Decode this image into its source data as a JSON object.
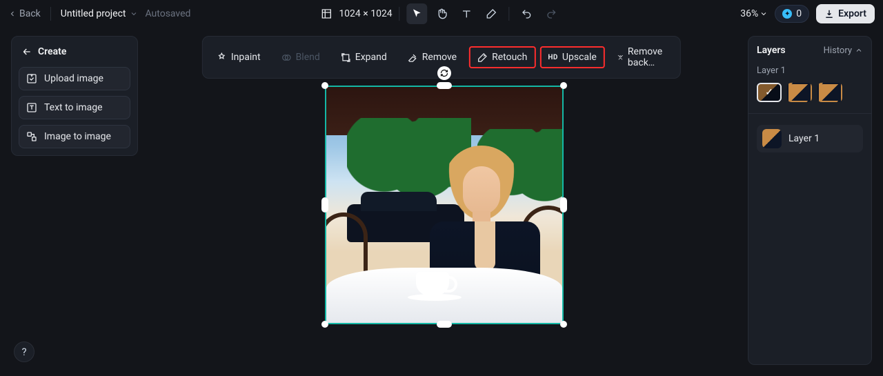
{
  "topbar": {
    "back": "Back",
    "project_name": "Untitled project",
    "autosaved": "Autosaved",
    "dimensions": "1024 × 1024",
    "zoom": "36%",
    "credits": "0",
    "export": "Export"
  },
  "left_panel": {
    "create": "Create",
    "upload": "Upload image",
    "text_to_image": "Text to image",
    "image_to_image": "Image to image"
  },
  "context_toolbar": {
    "inpaint": "Inpaint",
    "blend": "Blend",
    "expand": "Expand",
    "remove": "Remove",
    "retouch": "Retouch",
    "upscale": "Upscale",
    "remove_background": "Remove back…"
  },
  "right_panel": {
    "title": "Layers",
    "history": "History",
    "active_layer_label": "Layer 1",
    "layer_row_label": "Layer 1"
  },
  "canvas": {
    "description": "Woman with wavy golden hair in a dark navy blazer, smiling, seated at an outdoor cafe table with a cappuccino, palm trees and a parked car in the background at golden hour."
  }
}
